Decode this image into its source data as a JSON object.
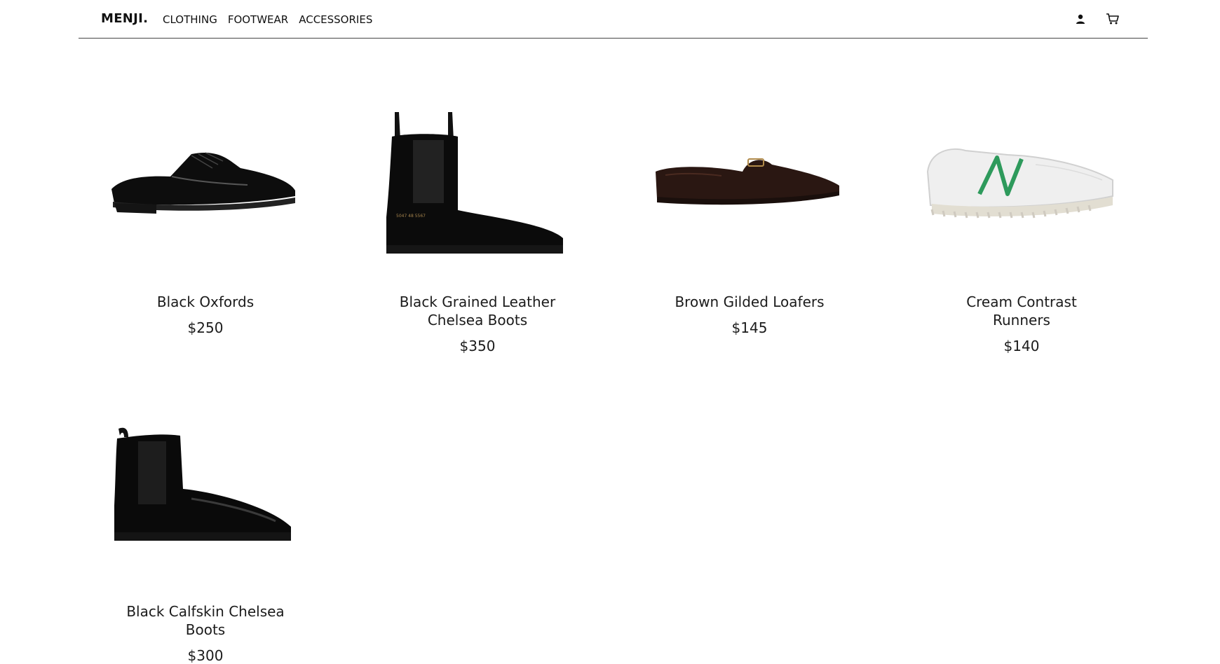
{
  "header": {
    "brand": "MENJI.",
    "nav": [
      "CLOTHING",
      "FOOTWEAR",
      "ACCESSORIES"
    ],
    "icons": [
      "user-icon",
      "cart-icon"
    ]
  },
  "products": [
    {
      "name": "Black Oxfords",
      "price": "$250",
      "image": "black-oxford-shoe"
    },
    {
      "name": "Black Grained Leather Chelsea Boots",
      "price": "$350",
      "image": "black-chelsea-boot"
    },
    {
      "name": "Brown Gilded Loafers",
      "price": "$145",
      "image": "brown-loafer"
    },
    {
      "name": "Cream Contrast Runners",
      "price": "$140",
      "image": "cream-runner-sneaker"
    },
    {
      "name": "Black Calfskin Chelsea Boots",
      "price": "$300",
      "image": "black-calfskin-boot"
    }
  ],
  "colors": {
    "text": "#1b1b1b",
    "divider": "#444444",
    "runner_accent": "#2e9a5c"
  }
}
